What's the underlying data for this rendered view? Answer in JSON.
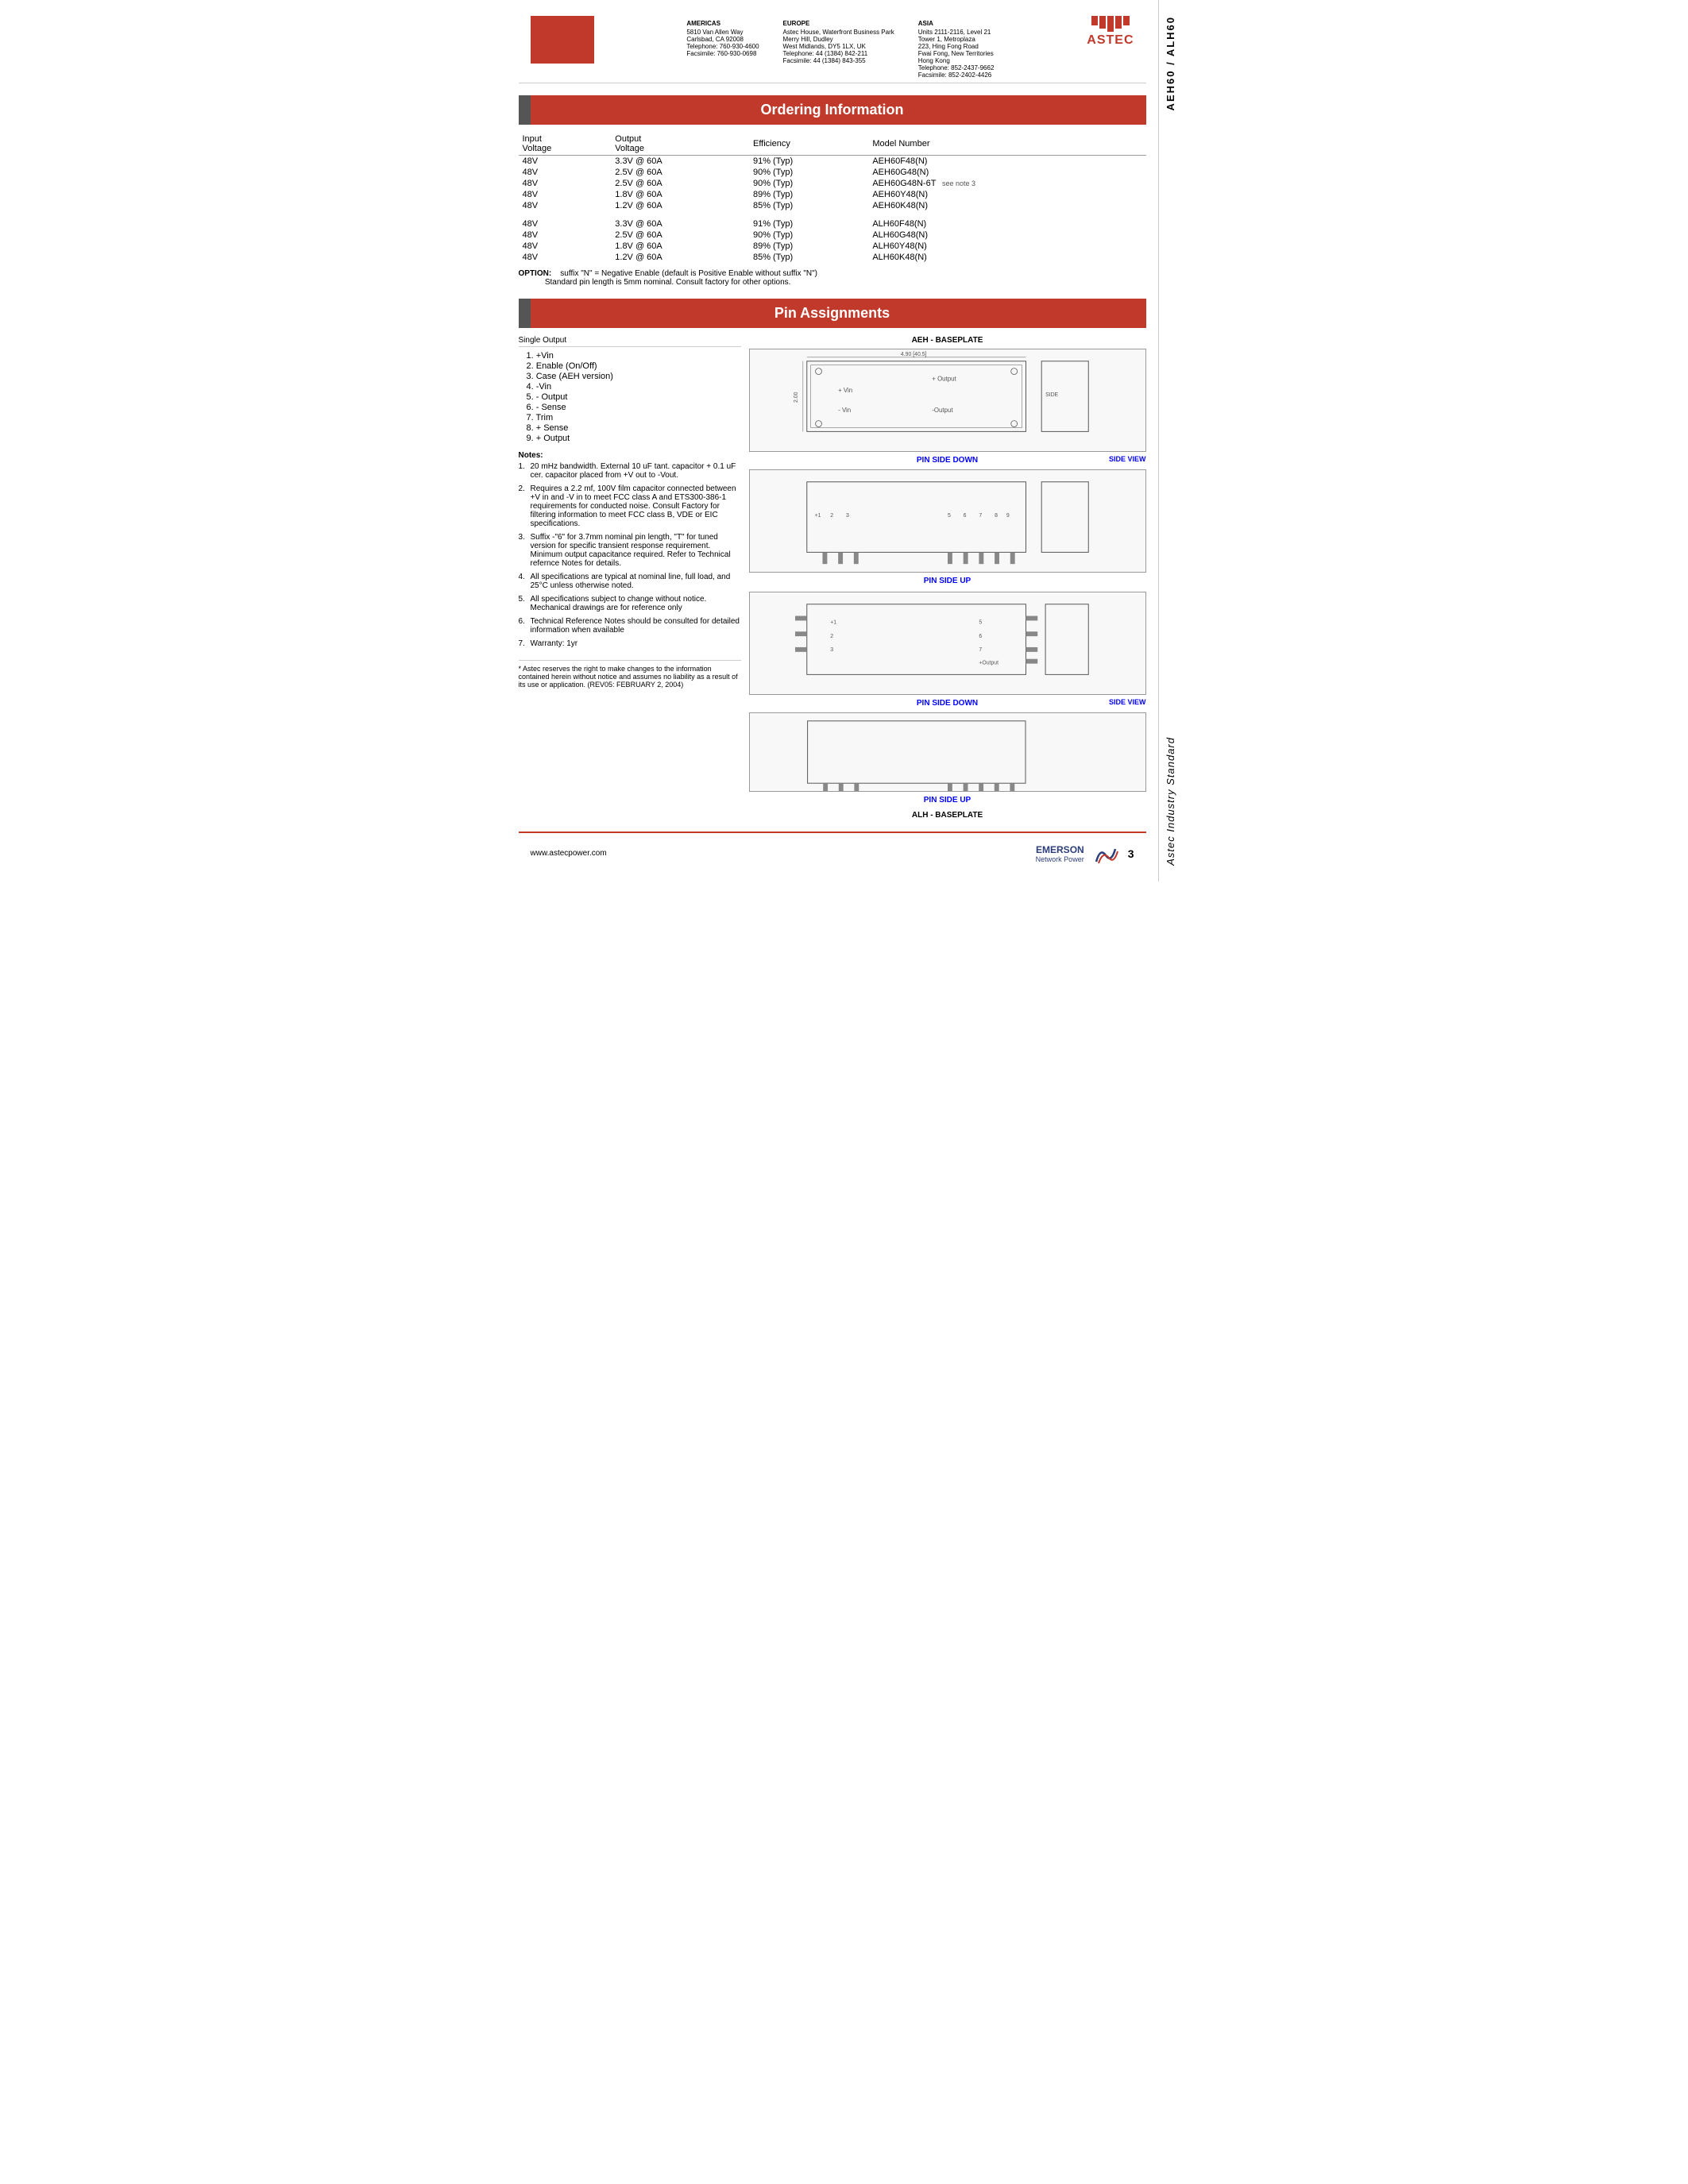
{
  "header": {
    "left_bar_color": "#c0392b",
    "regions": [
      {
        "name": "AMERICAS",
        "lines": [
          "5810 Van Allen Way",
          "Carlsbad, CA 92008",
          "Telephone: 760-930-4600",
          "Facsimile: 760-930-0698"
        ]
      },
      {
        "name": "EUROPE",
        "lines": [
          "Astec House, Waterfront Business Park",
          "Merry Hill, Dudley",
          "West Midlands, DY5 1LX, UK",
          "Telephone: 44 (1384) 842-211",
          "Facsimile: 44 (1384) 843-355"
        ]
      },
      {
        "name": "ASIA",
        "lines": [
          "Units 2111-2116, Level 21",
          "Tower 1, Metroplaza",
          "223, Hing Fong Road",
          "Fwai Fong, New Territories",
          "Hong Kong",
          "Telephone: 852-2437-9662",
          "Facsimile: 852-2402-4426"
        ]
      }
    ],
    "logo_text": "ASTEC"
  },
  "side_labels": {
    "top": "AEH60 / ALH60",
    "bottom": "Astec Industry Standard"
  },
  "ordering_section": {
    "title": "Ordering Information",
    "columns": [
      "Input\nVoltage",
      "Output\nVoltage",
      "Efficiency",
      "Model Number"
    ],
    "aeh_rows": [
      {
        "input": "48V",
        "output": "3.3V @ 60A",
        "efficiency": "91% (Typ)",
        "model": "AEH60F48(N)",
        "note": ""
      },
      {
        "input": "48V",
        "output": "2.5V @ 60A",
        "efficiency": "90% (Typ)",
        "model": "AEH60G48(N)",
        "note": ""
      },
      {
        "input": "48V",
        "output": "2.5V @ 60A",
        "efficiency": "90% (Typ)",
        "model": "AEH60G48N-6T",
        "note": "see note 3"
      },
      {
        "input": "48V",
        "output": "1.8V @ 60A",
        "efficiency": "89% (Typ)",
        "model": "AEH60Y48(N)",
        "note": ""
      },
      {
        "input": "48V",
        "output": "1.2V @ 60A",
        "efficiency": "85% (Typ)",
        "model": "AEH60K48(N)",
        "note": ""
      }
    ],
    "alh_rows": [
      {
        "input": "48V",
        "output": "3.3V @ 60A",
        "efficiency": "91% (Typ)",
        "model": "ALH60F48(N)"
      },
      {
        "input": "48V",
        "output": "2.5V @ 60A",
        "efficiency": "90% (Typ)",
        "model": "ALH60G48(N)"
      },
      {
        "input": "48V",
        "output": "1.8V @ 60A",
        "efficiency": "89% (Typ)",
        "model": "ALH60Y48(N)"
      },
      {
        "input": "48V",
        "output": "1.2V @ 60A",
        "efficiency": "85% (Typ)",
        "model": "ALH60K48(N)"
      }
    ],
    "option_label": "OPTION:",
    "option_text": "suffix \"N\" = Negative Enable (default is Positive Enable without suffix \"N\")",
    "option_text2": "Standard pin length is 5mm nominal. Consult factory for other options."
  },
  "pin_section": {
    "title": "Pin Assignments",
    "sub_title": "Single Output",
    "pins": [
      "1.  +Vin",
      "2.  Enable (On/Off)",
      "3.  Case (AEH version)",
      "4.  -Vin",
      "5.  - Output",
      "6.  - Sense",
      "7.  Trim",
      "8.  + Sense",
      "9.  + Output"
    ],
    "notes_title": "Notes:",
    "notes": [
      {
        "num": "1.",
        "text": "20 mHz bandwidth. External 10 uF tant. capacitor + 0.1 uF cer. capacitor placed from +V out to -Vout."
      },
      {
        "num": "2.",
        "text": "Requires a 2.2 mf, 100V film capacitor connected between +V in and -V in to meet FCC class A and ETS300-386-1 requirements for conducted noise. Consult Factory for filtering information to meet FCC class B, VDE or EIC specifications."
      },
      {
        "num": "3.",
        "text": "Suffix -\"6\" for 3.7mm nominal pin length, \"T\" for tuned version for specific transient response requirement. Minimum output capacitance required. Refer to Technical refernce Notes for details."
      },
      {
        "num": "4.",
        "text": "All specifications are typical at nominal line, full load, and 25°C unless otherwise noted."
      },
      {
        "num": "5.",
        "text": "All specifications subject to change without notice. Mechanical drawings are for reference only"
      },
      {
        "num": "6.",
        "text": "Technical Reference Notes should be consulted for detailed information when available"
      },
      {
        "num": "7.",
        "text": "Warranty: 1yr"
      }
    ],
    "aeh_baseplate_label": "AEH - BASEPLATE",
    "pin_side_down_label": "PIN SIDE DOWN",
    "side_view_label": "SIDE VIEW",
    "pin_side_up_label": "PIN SIDE UP",
    "alh_baseplate_label": "ALH - BASEPLATE"
  },
  "disclaimer": "* Astec reserves the right to make changes to the information contained herein without notice and assumes no liability as a result of its use or application. (REV05: FEBRUARY 2, 2004)",
  "footer": {
    "url": "www.astecpower.com",
    "company": "EMERSON",
    "company_sub": "Network Power",
    "page_num": "3"
  }
}
